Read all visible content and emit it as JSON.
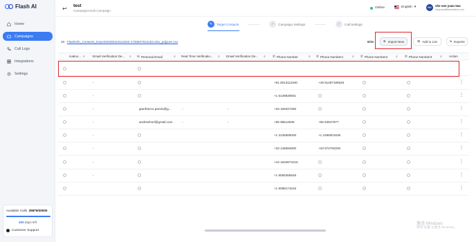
{
  "app": {
    "name": "Flash AI",
    "brand_color": "#3c7cf3",
    "highlight_color": "#e0242c"
  },
  "sidebar": {
    "items": [
      {
        "label": "Home",
        "icon": "home-icon",
        "active": false
      },
      {
        "label": "Campaigns",
        "icon": "campaign-icon",
        "active": true
      },
      {
        "label": "Call Logs",
        "icon": "phone-icon",
        "active": false
      },
      {
        "label": "Integrations",
        "icon": "integrations-icon",
        "active": false
      },
      {
        "label": "Settings",
        "icon": "gear-icon",
        "active": false
      }
    ],
    "calls_label": "Available Calls",
    "calls_value": "29879/30000",
    "calls_fraction": 0.996,
    "days_value": "400",
    "days_label": "days left",
    "support_label": "Customer Support"
  },
  "header": {
    "title": "test",
    "breadcrumb": "Campaigns-Edit Campaign",
    "status": "Online",
    "language": "English",
    "avatar_initials": "NO",
    "user_name": "she one yuan two",
    "user_email": "sheyuan@flashaitech.com"
  },
  "steps": [
    {
      "label": "Target Contacts",
      "active": true
    },
    {
      "label": "Campaign Settings",
      "active": false
    },
    {
      "label": "Call Settings",
      "active": false
    }
  ],
  "toolbar": {
    "file_number": "10",
    "file_name": "FlashInfo_Contacts_Export20250110111832-1736507912153.xlsx_pdg1ee.csv",
    "count": "6/10",
    "import_label": "Import New",
    "add_list_label": "Add to List",
    "exports_label": "Exports"
  },
  "table": {
    "columns": [
      "ication...",
      "Email Verification De...",
      "Personal Email",
      "Real Time Verificatio...",
      "Email Verification De...",
      "Phone Number",
      "Phone Number1",
      "Phone Number2",
      "Phone Number3",
      "Action"
    ],
    "rows": [
      {
        "c1": "",
        "c4": "",
        "email": "",
        "c6": "",
        "phone": "",
        "phone1": ""
      },
      {
        "c1": "-",
        "c4": "",
        "email": "",
        "c6": "",
        "phone": "+81 8013111940",
        "phone1": "+49 81487185526"
      },
      {
        "c1": "-",
        "c4": "",
        "email": "",
        "c6": "",
        "phone": "+1 5139838901",
        "phone1": ""
      },
      {
        "c1": "-",
        "c4": "-",
        "email": "gianfranco.parolo@g...",
        "c6": "-",
        "phone": "+33 184027250",
        "phone1": ""
      },
      {
        "c1": "-",
        "c4": "-",
        "email": "andrewhorl@gmail.com",
        "c6": "-",
        "phone": "+65 96514636",
        "phone1": "+65 64847877"
      },
      {
        "c1": "-",
        "c4": "",
        "email": "",
        "c6": "",
        "phone": "+1 3135565000",
        "phone1": "+1 2486001638"
      },
      {
        "c1": "-",
        "c4": "",
        "email": "",
        "c6": "",
        "phone": "+33 146694800",
        "phone1": "+33 674793200"
      },
      {
        "c1": "-",
        "c4": "",
        "email": "",
        "c6": "",
        "phone": "+44 1634874216",
        "phone1": ""
      },
      {
        "c1": "-",
        "c4": "",
        "email": "",
        "c6": "",
        "phone": "+1 8555355648",
        "phone1": ""
      },
      {
        "c1": "",
        "c4": "",
        "email": "",
        "c6": "",
        "phone": "+1 9098171616",
        "phone1": ""
      }
    ]
  },
  "watermark": {
    "line1": "激活 Windows",
    "line2": "转到\"设置\"以激活 Windows。"
  }
}
